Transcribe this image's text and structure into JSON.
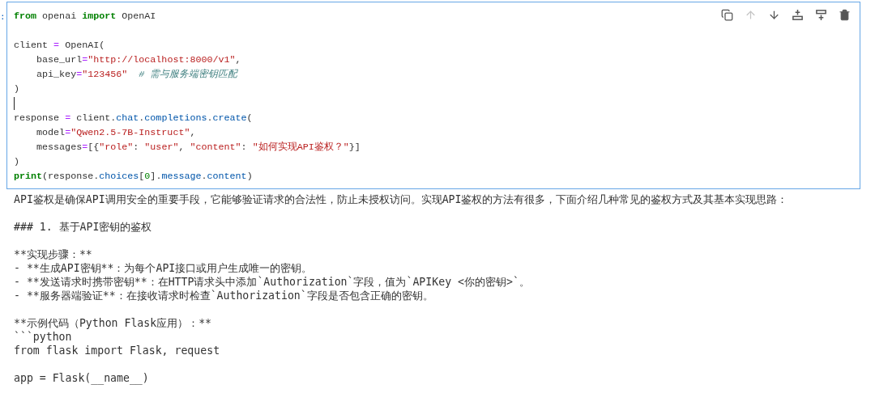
{
  "prompt": ":",
  "toolbar": [
    {
      "kind": "duplicate",
      "disabled": false
    },
    {
      "kind": "move-up",
      "disabled": true
    },
    {
      "kind": "move-down",
      "disabled": false
    },
    {
      "kind": "insert-above",
      "disabled": false
    },
    {
      "kind": "insert-below",
      "disabled": false
    },
    {
      "kind": "delete",
      "disabled": false
    }
  ],
  "code_lines": [
    {
      "cursor": false,
      "tokens": [
        {
          "t": "from",
          "kind": "kw"
        },
        {
          "t": " openai ",
          "kind": "plain"
        },
        {
          "t": "import",
          "kind": "kw"
        },
        {
          "t": " OpenAI",
          "kind": "plain"
        }
      ]
    },
    {
      "kind": "blank"
    },
    {
      "cursor": false,
      "tokens": [
        {
          "t": "client ",
          "kind": "plain"
        },
        {
          "t": "=",
          "kind": "op"
        },
        {
          "t": " OpenAI(",
          "kind": "plain"
        }
      ]
    },
    {
      "cursor": false,
      "tokens": [
        {
          "t": "    base_url",
          "kind": "plain"
        },
        {
          "t": "=",
          "kind": "op"
        },
        {
          "t": "\"http://localhost:8000/v1\"",
          "kind": "str"
        },
        {
          "t": ",",
          "kind": "plain"
        }
      ]
    },
    {
      "cursor": false,
      "tokens": [
        {
          "t": "    api_key",
          "kind": "plain"
        },
        {
          "t": "=",
          "kind": "op"
        },
        {
          "t": "\"123456\"",
          "kind": "str"
        },
        {
          "t": "  # 需与服务端密钥匹配",
          "kind": "comment"
        }
      ]
    },
    {
      "cursor": false,
      "tokens": [
        {
          "t": ")",
          "kind": "plain"
        }
      ]
    },
    {
      "kind": "blank",
      "cursor": true
    },
    {
      "cursor": false,
      "tokens": [
        {
          "t": "response ",
          "kind": "plain"
        },
        {
          "t": "=",
          "kind": "op"
        },
        {
          "t": " client",
          "kind": "plain"
        },
        {
          "t": ".",
          "kind": "plain"
        },
        {
          "t": "chat",
          "kind": "attr"
        },
        {
          "t": ".",
          "kind": "plain"
        },
        {
          "t": "completions",
          "kind": "attr"
        },
        {
          "t": ".",
          "kind": "plain"
        },
        {
          "t": "create",
          "kind": "attr"
        },
        {
          "t": "(",
          "kind": "plain"
        }
      ]
    },
    {
      "cursor": false,
      "tokens": [
        {
          "t": "    model",
          "kind": "plain"
        },
        {
          "t": "=",
          "kind": "op"
        },
        {
          "t": "\"Qwen2.5-7B-Instruct\"",
          "kind": "str"
        },
        {
          "t": ",",
          "kind": "plain"
        }
      ]
    },
    {
      "cursor": false,
      "tokens": [
        {
          "t": "    messages",
          "kind": "plain"
        },
        {
          "t": "=",
          "kind": "op"
        },
        {
          "t": "[{",
          "kind": "plain"
        },
        {
          "t": "\"role\"",
          "kind": "str"
        },
        {
          "t": ": ",
          "kind": "plain"
        },
        {
          "t": "\"user\"",
          "kind": "str"
        },
        {
          "t": ", ",
          "kind": "plain"
        },
        {
          "t": "\"content\"",
          "kind": "str"
        },
        {
          "t": ": ",
          "kind": "plain"
        },
        {
          "t": "\"如何实现API鉴权？\"",
          "kind": "str"
        },
        {
          "t": "}]",
          "kind": "plain"
        }
      ]
    },
    {
      "cursor": false,
      "tokens": [
        {
          "t": ")",
          "kind": "plain"
        }
      ]
    },
    {
      "cursor": false,
      "tokens": [
        {
          "t": "print",
          "kind": "kw"
        },
        {
          "t": "(response",
          "kind": "plain"
        },
        {
          "t": ".",
          "kind": "plain"
        },
        {
          "t": "choices",
          "kind": "attr"
        },
        {
          "t": "[",
          "kind": "plain"
        },
        {
          "t": "0",
          "kind": "num"
        },
        {
          "t": "]",
          "kind": "plain"
        },
        {
          "t": ".",
          "kind": "plain"
        },
        {
          "t": "message",
          "kind": "attr"
        },
        {
          "t": ".",
          "kind": "plain"
        },
        {
          "t": "content",
          "kind": "attr"
        },
        {
          "t": ")",
          "kind": "plain"
        }
      ]
    }
  ],
  "output_blocks": [
    [
      "API鉴权是确保API调用安全的重要手段，它能够验证请求的合法性，防止未授权访问。实现API鉴权的方法有很多，下面介绍几种常见的鉴权方式及其基本实现思路："
    ],
    [
      "### 1. 基于API密钥的鉴权"
    ],
    [
      "**实现步骤：**",
      "- **生成API密钥**：为每个API接口或用户生成唯一的密钥。",
      "- **发送请求时携带密钥**：在HTTP请求头中添加`Authorization`字段，值为`APIKey <你的密钥>`。",
      "- **服务器端验证**：在接收请求时检查`Authorization`字段是否包含正确的密钥。"
    ],
    [
      "**示例代码（Python Flask应用）：**",
      "```python",
      "from flask import Flask, request"
    ],
    [
      "app = Flask(__name__)"
    ]
  ]
}
